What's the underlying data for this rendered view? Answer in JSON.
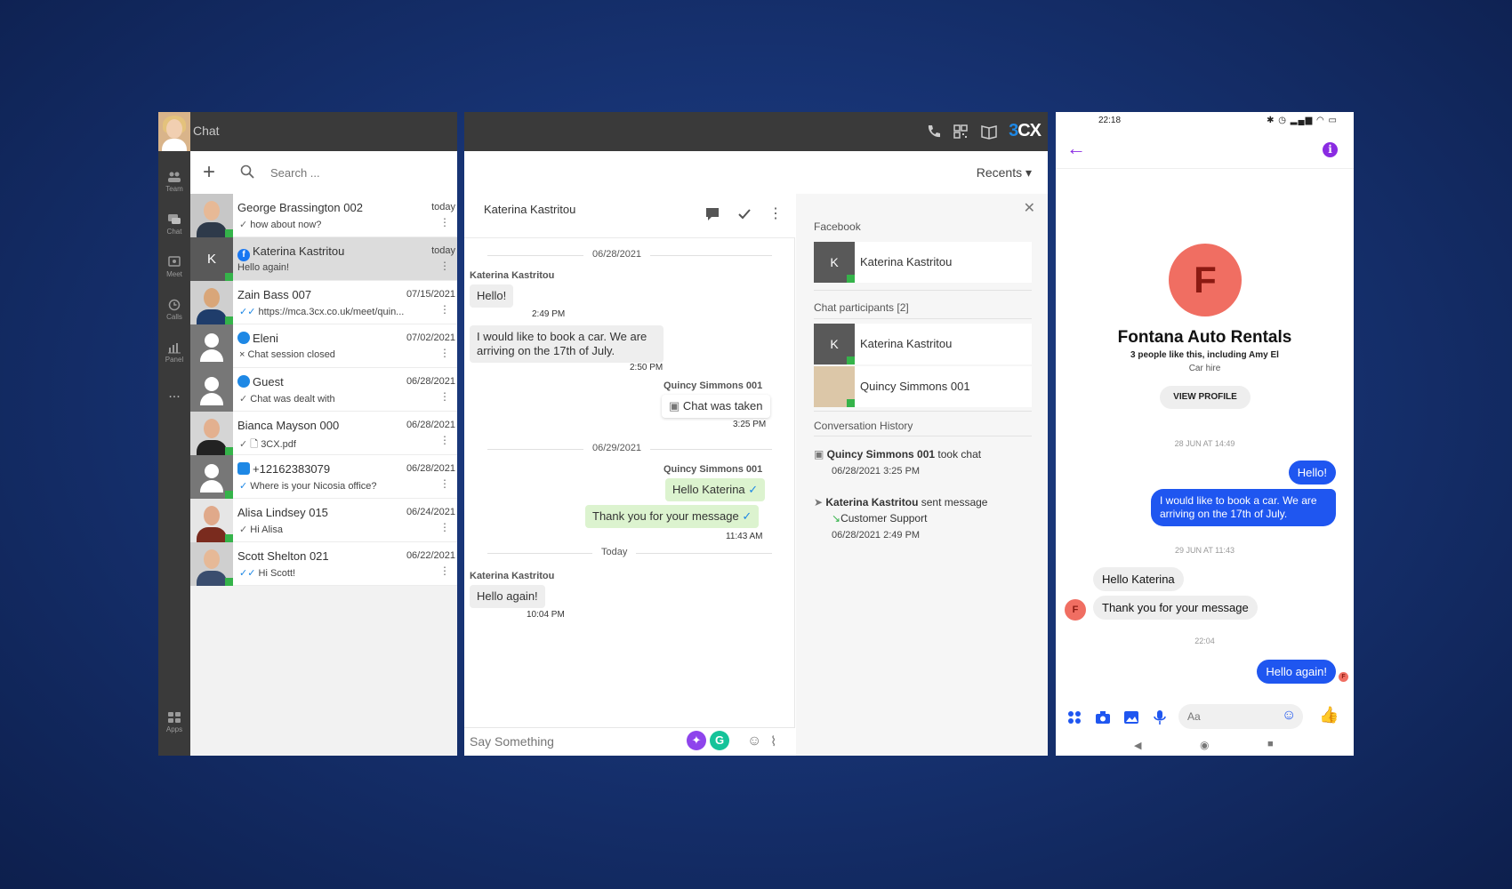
{
  "left": {
    "title": "Chat",
    "search_placeholder": "Search ...",
    "rail": [
      {
        "label": "Team",
        "icon": "team-icon"
      },
      {
        "label": "Chat",
        "icon": "chat-icon"
      },
      {
        "label": "Meet",
        "icon": "meet-icon"
      },
      {
        "label": "Calls",
        "icon": "calls-icon"
      },
      {
        "label": "Panel",
        "icon": "panel-icon"
      },
      {
        "label": "...",
        "icon": "more-icon"
      },
      {
        "label": "Apps",
        "icon": "apps-icon"
      }
    ],
    "contacts": [
      {
        "name": "George Brassington 002",
        "date": "today",
        "preview": "how about now?"
      },
      {
        "name": "Katerina Kastritou",
        "date": "today",
        "preview": "Hello again!",
        "initial": "K"
      },
      {
        "name": "Zain Bass 007",
        "date": "07/15/2021",
        "preview": "https://mca.3cx.co.uk/meet/quin..."
      },
      {
        "name": "Eleni",
        "date": "07/02/2021",
        "preview": "Chat session closed"
      },
      {
        "name": "Guest",
        "date": "06/28/2021",
        "preview": "Chat was dealt with"
      },
      {
        "name": "Bianca Mayson 000",
        "date": "06/28/2021",
        "preview": "3CX.pdf"
      },
      {
        "name": "+12162383079",
        "date": "06/28/2021",
        "preview": "Where is your Nicosia office?"
      },
      {
        "name": "Alisa Lindsey 015",
        "date": "06/24/2021",
        "preview": "Hi Alisa"
      },
      {
        "name": "Scott Shelton 021",
        "date": "06/22/2021",
        "preview": "Hi Scott!"
      }
    ]
  },
  "mid": {
    "logo_num": "3",
    "logo_text": "CX",
    "recents": "Recents ▾",
    "conv_name": "Katerina Kastritou",
    "dates": [
      "06/28/2021",
      "06/29/2021",
      "Today"
    ],
    "messages": [
      {
        "sender": "Katerina Kastritou",
        "text": "Hello!",
        "time": "2:49 PM"
      },
      {
        "text_1": "I would like to book a car. We are",
        "text_2": "arriving on the 17th of July.",
        "time": "2:50 PM"
      },
      {
        "sender": "Quincy Simmons 001",
        "text": "Chat was taken",
        "time": "3:25 PM"
      },
      {
        "sender": "Quincy Simmons 001",
        "text": "Hello Katerina"
      },
      {
        "text": "Thank you for your message",
        "time": "11:43 AM"
      },
      {
        "sender": "Katerina Kastritou",
        "text": "Hello again!",
        "time": "10:04 PM"
      }
    ],
    "composer_placeholder": "Say Something",
    "side": {
      "facebook_label": "Facebook",
      "fb_contact": "Katerina Kastritou",
      "participants_label": "Chat participants [2]",
      "participants": [
        "Katerina Kastritou",
        "Quincy Simmons 001"
      ],
      "history_label": "Conversation History",
      "h1_who": "Quincy Simmons 001",
      "h1_what": " took chat",
      "h1_date": "06/28/2021 3:25 PM",
      "h2_who": "Katerina Kastritou",
      "h2_what": " sent message",
      "h2_to": "Customer Support",
      "h2_date": "06/28/2021 2:49 PM"
    }
  },
  "mobile": {
    "time": "22:18",
    "biz_initial": "F",
    "biz_name": "Fontana Auto Rentals",
    "likes": "3 people like this, including Amy El",
    "category": "Car hire",
    "view_profile": "VIEW PROFILE",
    "stamps": [
      "28 JUN AT 14:49",
      "29 JUN AT 11:43",
      "22:04"
    ],
    "msgs": {
      "hello": "Hello!",
      "book_1": "I would like to book a car. We are",
      "book_2": "arriving on the 17th of July.",
      "hello_k": "Hello Katerina",
      "thanks": "Thank you for your message",
      "again": "Hello again!"
    },
    "input_placeholder": "Aa"
  },
  "colors": {
    "accent_blue": "#1e88e5",
    "presence_green": "#35b34a",
    "messenger_blue": "#1f56f0",
    "messenger_purple": "#8a2be2",
    "fontana_red": "#f06e62"
  }
}
